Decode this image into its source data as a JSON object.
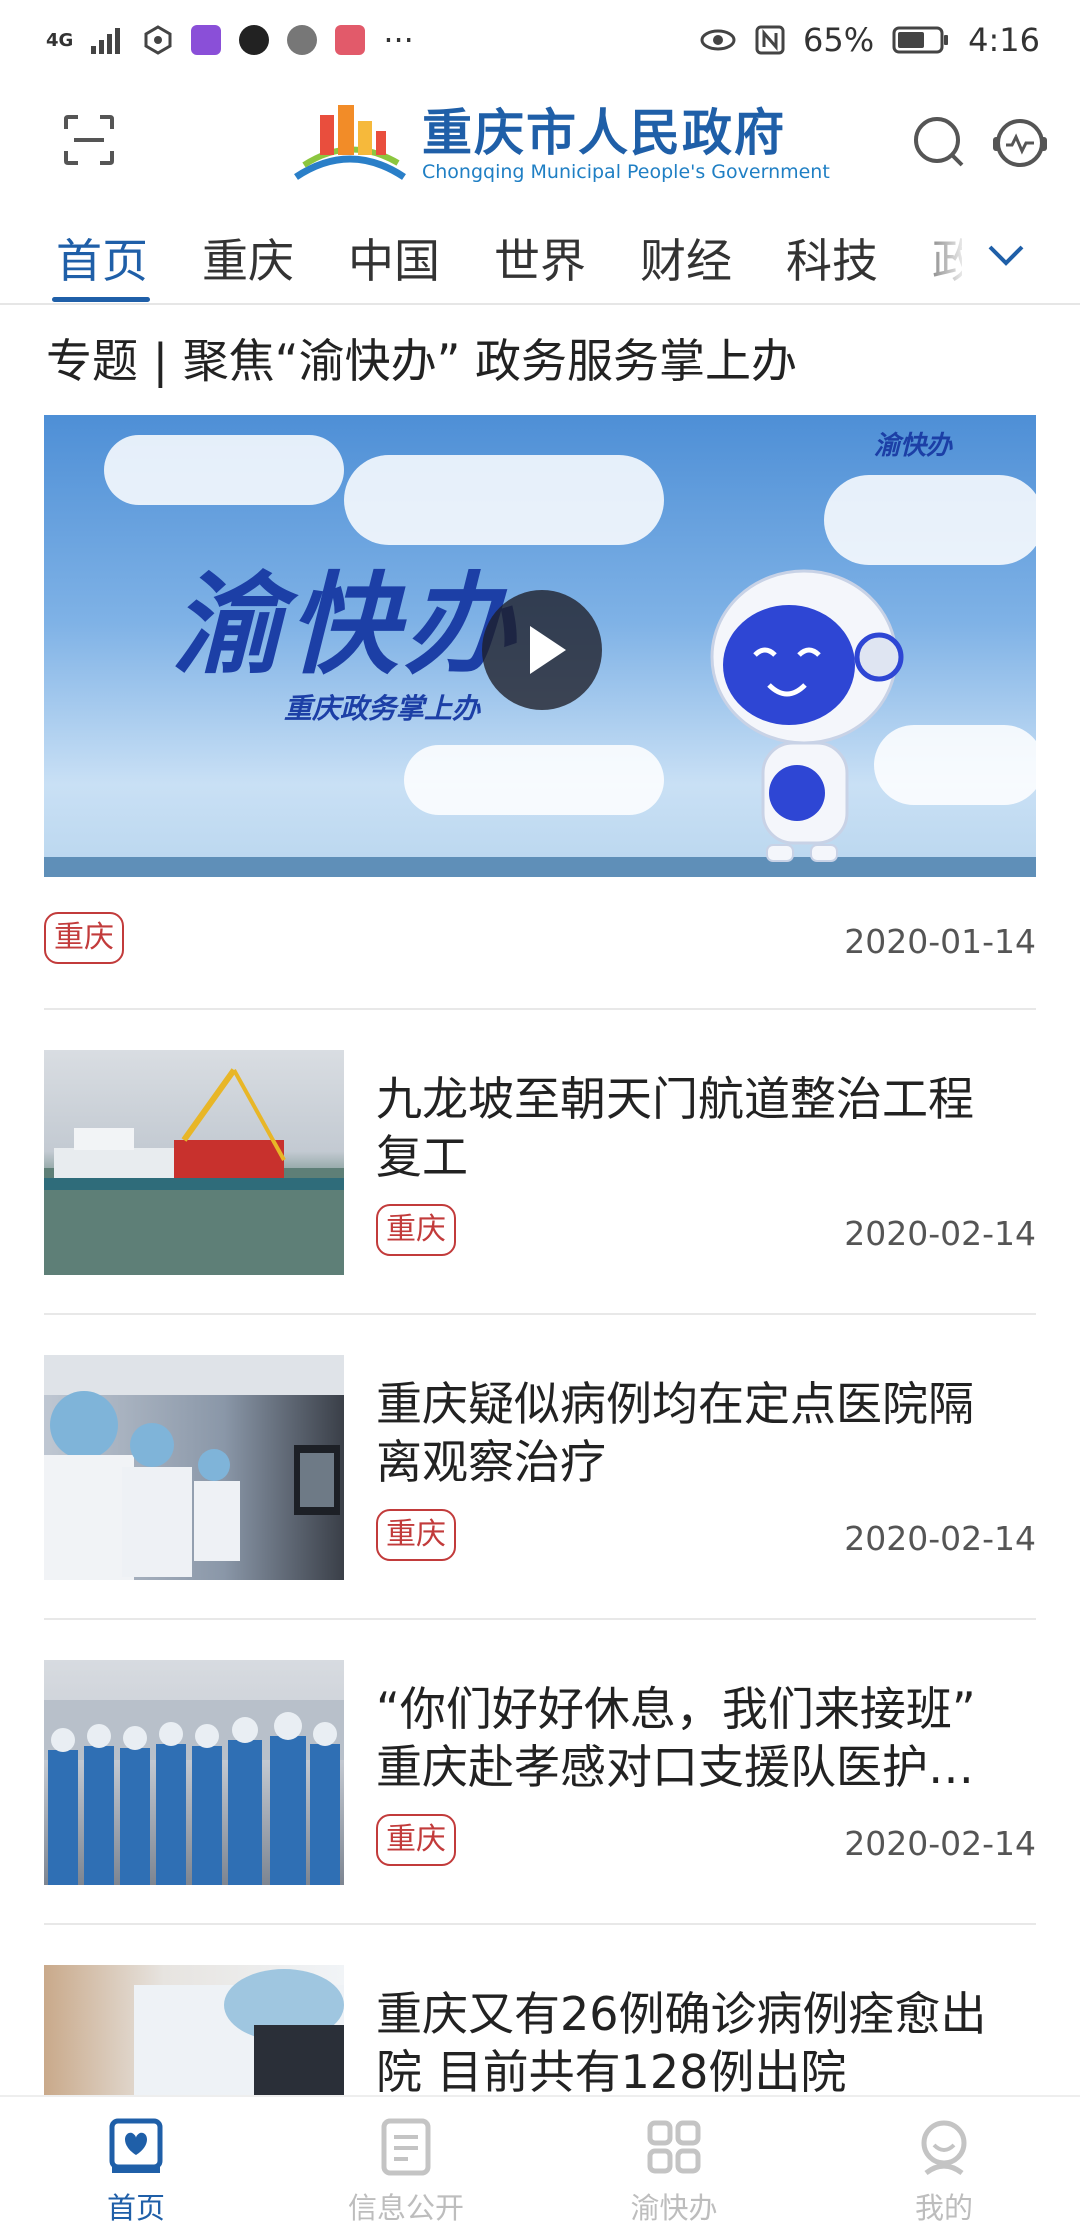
{
  "status_bar": {
    "network": "4G",
    "battery": "65%",
    "time": "4:16",
    "more": "···"
  },
  "header": {
    "title": "重庆市人民政府",
    "subtitle": "Chongqing Municipal People's Government"
  },
  "tabs": [
    "首页",
    "重庆",
    "中国",
    "世界",
    "财经",
    "科技",
    "政"
  ],
  "active_tab": "首页",
  "topic": {
    "title": "专题 | 聚焦“渝快办” 政务服务掌上办",
    "video_brand": "渝快办",
    "video_slogan": "重庆政务掌上办",
    "badge": "渝快办",
    "tag": "重庆",
    "date": "2020-01-14"
  },
  "news": [
    {
      "title": "九龙坡至朝天门航道整治工程复工",
      "tag": "重庆",
      "date": "2020-02-14",
      "thumb": "barge-crane-on-river"
    },
    {
      "title": "重庆疑似病例均在定点医院隔离观察治疗",
      "tag": "重庆",
      "date": "2020-02-14",
      "thumb": "doctors-viewing-xray"
    },
    {
      "title": "“你们好好休息，我们来接班” 重庆赴孝感对口支援队医护…",
      "tag": "重庆",
      "date": "2020-02-14",
      "thumb": "medical-team-group"
    },
    {
      "title": "重庆又有26例确诊病例痊愈出院 目前共有128例出院",
      "tag": "",
      "date": "",
      "thumb": "doctor-in-mask"
    }
  ],
  "bottom_nav": [
    {
      "label": "首页",
      "icon": "home-icon",
      "active": true
    },
    {
      "label": "信息公开",
      "icon": "document-icon",
      "active": false
    },
    {
      "label": "渝快办",
      "icon": "grid-icon",
      "active": false
    },
    {
      "label": "我的",
      "icon": "profile-icon",
      "active": false
    }
  ],
  "colors": {
    "brand": "#1f5fa8",
    "tag": "#c23b3b",
    "inactive": "#bdbdbd"
  }
}
